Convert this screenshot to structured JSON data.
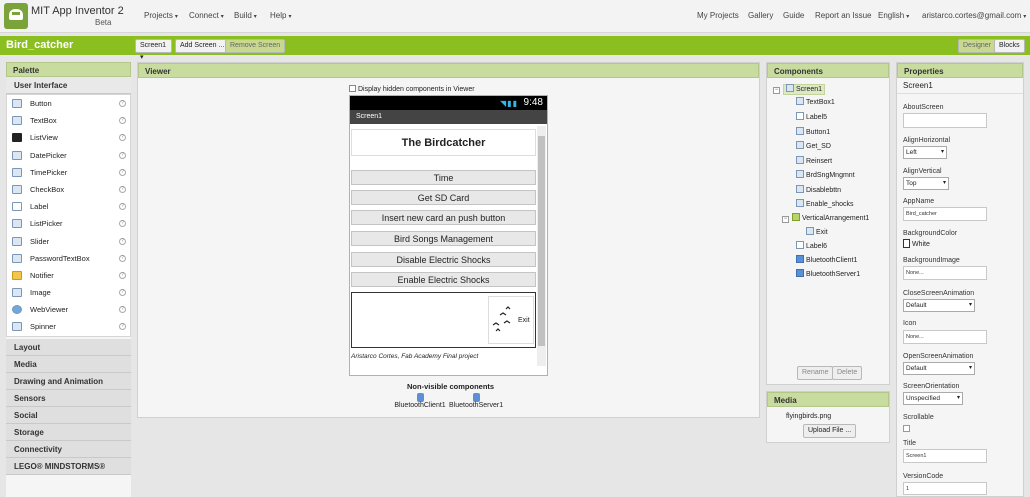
{
  "topbar": {
    "app_name": "MIT App Inventor 2",
    "app_sub": "Beta",
    "menus": [
      "Projects",
      "Connect",
      "Build",
      "Help"
    ],
    "links": [
      "My Projects",
      "Gallery",
      "Guide",
      "Report an Issue",
      "English",
      "aristarco.cortes@gmail.com"
    ]
  },
  "project_bar": {
    "project_name": "Bird_catcher",
    "screen_select": "Screen1",
    "add_screen": "Add Screen ...",
    "remove_screen": "Remove Screen",
    "designer": "Designer",
    "blocks": "Blocks"
  },
  "palette": {
    "title": "Palette",
    "open_category": "User Interface",
    "items": [
      "Button",
      "TextBox",
      "ListView",
      "DatePicker",
      "TimePicker",
      "CheckBox",
      "Label",
      "ListPicker",
      "Slider",
      "PasswordTextBox",
      "Notifier",
      "Image",
      "WebViewer",
      "Spinner"
    ],
    "categories": [
      "Layout",
      "Media",
      "Drawing and Animation",
      "Sensors",
      "Social",
      "Storage",
      "Connectivity",
      "LEGO® MINDSTORMS®"
    ]
  },
  "viewer": {
    "title": "Viewer",
    "hidden_checkbox_label": "Display hidden components in Viewer",
    "phone": {
      "clock": "9:48",
      "screen_title": "Screen1",
      "heading": "The Birdcatcher",
      "buttons": [
        "Time",
        "Get SD Card",
        "Insert new card an push button",
        "Bird Songs Management",
        "Disable Electric Shocks",
        "Enable Electric Shocks"
      ],
      "exit_label": "Exit",
      "footer": "Aristarco Cortes, Fab Academy Final project"
    },
    "non_visible_title": "Non-visible components",
    "non_visible": [
      "BluetoothClient1",
      "BluetoothServer1"
    ]
  },
  "components": {
    "title": "Components",
    "root": "Screen1",
    "children": [
      "TextBox1",
      "Label5",
      "Button1",
      "Get_SD",
      "Reinsert",
      "BrdSngMngmnt",
      "Disablebttn",
      "Enable_shocks"
    ],
    "arrangement": "VerticalArrangement1",
    "arrangement_child": "Exit",
    "after": [
      "Label6",
      "BluetoothClient1",
      "BluetoothServer1"
    ],
    "rename": "Rename",
    "delete": "Delete"
  },
  "media": {
    "title": "Media",
    "file": "flyingbirds.png",
    "upload": "Upload File ..."
  },
  "properties": {
    "title": "Properties",
    "component": "Screen1",
    "about_label": "AboutScreen",
    "align_h_label": "AlignHorizontal",
    "align_h_value": "Left",
    "align_v_label": "AlignVertical",
    "align_v_value": "Top",
    "app_name_label": "AppName",
    "app_name_value": "Bird_catcher",
    "bgcolor_label": "BackgroundColor",
    "bgcolor_value": "White",
    "bgimage_label": "BackgroundImage",
    "bgimage_value": "None...",
    "close_anim_label": "CloseScreenAnimation",
    "close_anim_value": "Default",
    "icon_label": "Icon",
    "icon_value": "None...",
    "open_anim_label": "OpenScreenAnimation",
    "open_anim_value": "Default",
    "orientation_label": "ScreenOrientation",
    "orientation_value": "Unspecified",
    "scrollable_label": "Scrollable",
    "title_label": "Title",
    "title_value": "Screen1",
    "version_label": "VersionCode",
    "version_value": "1"
  }
}
